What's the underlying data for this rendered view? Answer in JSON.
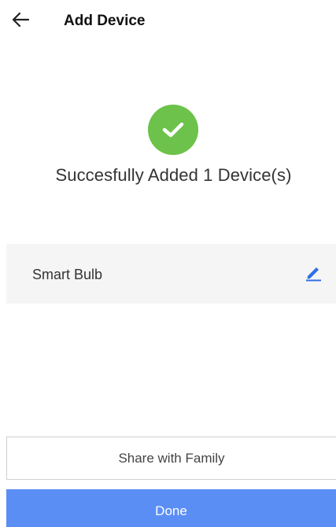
{
  "header": {
    "back_icon": "arrow-left-icon",
    "title": "Add Device"
  },
  "success": {
    "icon": "check-circle-icon",
    "icon_color": "#6cc24a",
    "message": "Succesfully Added 1 Device(s)"
  },
  "device": {
    "name": "Smart Bulb",
    "edit_icon": "pencil-icon",
    "edit_icon_color": "#2f6fe4"
  },
  "actions": {
    "share_label": "Share with Family",
    "done_label": "Done",
    "done_color": "#5b8ef4"
  }
}
